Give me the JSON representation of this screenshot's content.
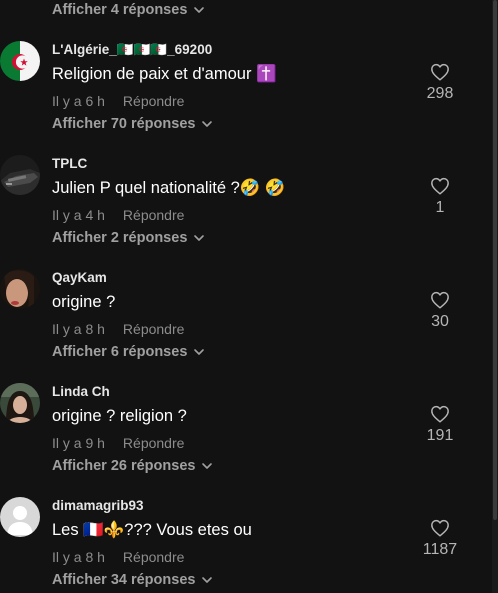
{
  "top_replies": {
    "label": "Afficher 4 réponses"
  },
  "comments": [
    {
      "username": "L'Algérie_🇩🇿🇩🇿🇩🇿_69200",
      "text": "Religion de paix et d'amour ✝️",
      "time": "Il y a 6 h",
      "reply_label": "Répondre",
      "likes": "298",
      "replies_label": "Afficher 70 réponses",
      "avatar": "algeria-flag-avatar"
    },
    {
      "username": "TPLC",
      "text": "Julien P quel nationalité ?🤣 🤣",
      "time": "Il y a 4 h",
      "reply_label": "Répondre",
      "likes": "1",
      "replies_label": "Afficher 2 réponses",
      "avatar": "car-photo-avatar"
    },
    {
      "username": "QayKam",
      "text": "origine ?",
      "time": "Il y a 8 h",
      "reply_label": "Répondre",
      "likes": "30",
      "replies_label": "Afficher 6 réponses",
      "avatar": "person-photo-avatar"
    },
    {
      "username": "Linda Ch",
      "text": "origine ? religion ?",
      "time": "Il y a 9 h",
      "reply_label": "Répondre",
      "likes": "191",
      "replies_label": "Afficher 26 réponses",
      "avatar": "person-photo-avatar"
    },
    {
      "username": "dimamagrib93",
      "text": "Les 🇫🇷⚜️??? Vous etes ou",
      "time": "Il y a 8 h",
      "reply_label": "Répondre",
      "likes": "1187",
      "replies_label": "Afficher 34 réponses",
      "avatar": "default-user-avatar"
    }
  ],
  "colors": {
    "background": "#121212",
    "secondary_text": "#8c8c8c",
    "replies_text": "#a0a0a0"
  }
}
